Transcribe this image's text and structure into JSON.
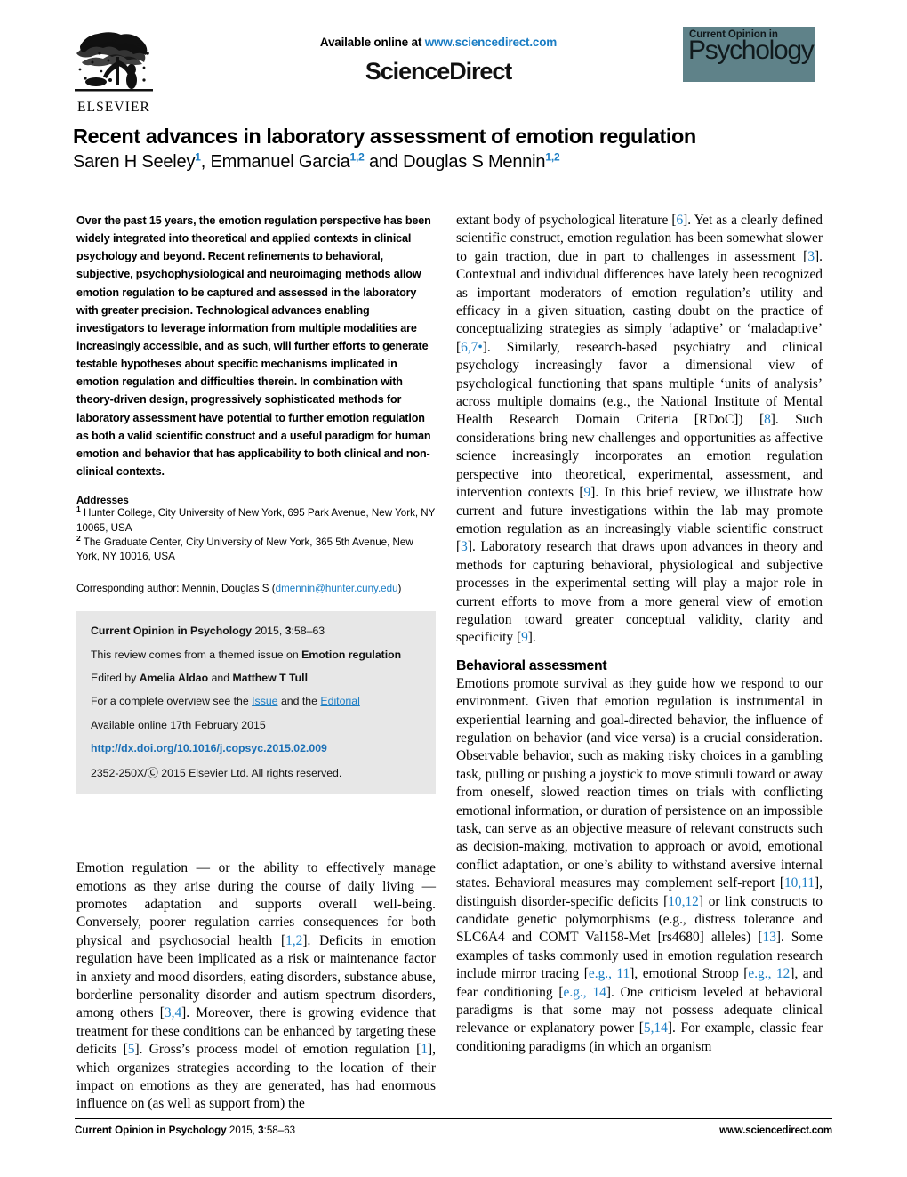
{
  "masthead": {
    "available_online_prefix": "Available online at ",
    "sciencedirect_url": "www.sciencedirect.com",
    "sciencedirect_wordmark": "ScienceDirect",
    "elsevier_wordmark": "ELSEVIER",
    "journal_badge_line1": "Current Opinion in",
    "journal_badge_line2": "Psychology",
    "badge_color": "#5f8289",
    "link_color": "#1a7dc4"
  },
  "title": {
    "article_title": "Recent advances in laboratory assessment of emotion regulation",
    "authors_plain": "Saren H Seeley1, Emmanuel Garcia1,2 and Douglas S Mennin1,2",
    "author_parts": [
      {
        "name": "Saren H Seeley",
        "sup": "1",
        "sep": ", "
      },
      {
        "name": "Emmanuel Garcia",
        "sup": "1,2",
        "sep": " and "
      },
      {
        "name": "Douglas S Mennin",
        "sup": "1,2",
        "sep": ""
      }
    ]
  },
  "abstract": {
    "text": "Over the past 15 years, the emotion regulation perspective has been widely integrated into theoretical and applied contexts in clinical psychology and beyond. Recent refinements to behavioral, subjective, psychophysiological and neuroimaging methods allow emotion regulation to be captured and assessed in the laboratory with greater precision. Technological advances enabling investigators to leverage information from multiple modalities are increasingly accessible, and as such, will further efforts to generate testable hypotheses about specific mechanisms implicated in emotion regulation and difficulties therein. In combination with theory-driven design, progressively sophisticated methods for laboratory assessment have potential to further emotion regulation as both a valid scientific construct and a useful paradigm for human emotion and behavior that has applicability to both clinical and non-clinical contexts."
  },
  "addresses": {
    "heading": "Addresses",
    "items": [
      {
        "sup": "1",
        "text": " Hunter College, City University of New York, 695 Park Avenue, New York, NY 10065, USA"
      },
      {
        "sup": "2",
        "text": " The Graduate Center, City University of New York, 365 5th Avenue, New York, NY 10016, USA"
      }
    ],
    "corresponding_prefix": "Corresponding author: Mennin, Douglas S (",
    "corresponding_email": "dmennin@hunter.cuny.edu",
    "corresponding_suffix": ")"
  },
  "info_box": {
    "citation_bold": "Current Opinion in Psychology",
    "citation_rest_a": " 2015, ",
    "citation_volume": "3",
    "citation_rest_b": ":58–63",
    "themed_prefix": "This review comes from a themed issue on ",
    "themed_bold": "Emotion regulation",
    "edited_prefix": "Edited by ",
    "editor1": "Amelia Aldao",
    "edited_mid": " and ",
    "editor2": "Matthew T Tull",
    "overview_prefix": "For a complete overview see the ",
    "overview_link1": "Issue",
    "overview_mid": " and the ",
    "overview_link2": "Editorial",
    "available_online": "Available online 17th February 2015",
    "doi": "http://dx.doi.org/10.1016/j.copsyc.2015.02.009",
    "copyright": "2352-250X/Ⓒ 2015 Elsevier Ltd. All rights reserved."
  },
  "body": {
    "left_paragraph_1_pre": "Emotion regulation — or the ability to effectively manage emotions as they arise during the course of daily living — promotes adaptation and supports overall well-being. Conversely, poorer regulation carries consequences for both physical and psychosocial health [",
    "left_ref_1_2": "1,2",
    "left_p1_b": "]. Deficits in emotion regulation have been implicated as a risk or maintenance factor in anxiety and mood disorders, eating disorders, substance abuse, borderline personality disorder and autism spectrum disorders, among others [",
    "left_ref_3_4": "3,4",
    "left_p1_c": "]. Moreover, there is growing evidence that treatment for these conditions can be enhanced by targeting these deficits [",
    "left_ref_5": "5",
    "left_p1_d": "]. Gross’s process model of emotion regulation [",
    "left_ref_1": "1",
    "left_p1_e": "], which organizes strategies according to the location of their impact on emotions as they are generated, has had enormous influence on (as well as support from) the",
    "right_p1_a": "extant body of psychological literature [",
    "right_ref_6": "6",
    "right_p1_b": "]. Yet as a clearly defined scientific construct, emotion regulation has been somewhat slower to gain traction, due in part to challenges in assessment [",
    "right_ref_3": "3",
    "right_p1_c": "]. Contextual and individual differences have lately been recognized as important moderators of emotion regulation’s utility and efficacy in a given situation, casting doubt on the practice of conceptualizing strategies as simply ‘adaptive’ or ‘maladaptive’ [",
    "right_ref_6_7": "6,7",
    "right_ref_6_7_mark": "•",
    "right_p1_d": "]. Similarly, research-based psychiatry and clinical psychology increasingly favor a dimensional view of psychological functioning that spans multiple ‘units of analysis’ across multiple domains (e.g., the National Institute of Mental Health Research Domain Criteria [RDoC]) [",
    "right_ref_8": "8",
    "right_p1_e": "]. Such considerations bring new challenges and opportunities as affective science increasingly incorporates an emotion regulation perspective into theoretical, experimental, assessment, and intervention contexts [",
    "right_ref_9": "9",
    "right_p1_f": "]. In this brief review, we illustrate how current and future investigations within the lab may promote emotion regulation as an increasingly viable scientific construct [",
    "right_ref_3b": "3",
    "right_p1_g": "]. Laboratory research that draws upon advances in theory and methods for capturing behavioral, physiological and subjective processes in the experimental setting will play a major role in current efforts to move from a more general view of emotion regulation toward greater conceptual validity, clarity and specificity [",
    "right_ref_9b": "9",
    "right_p1_h": "].",
    "section_heading": "Behavioral assessment",
    "right_p2_a": "Emotions promote survival as they guide how we respond to our environment. Given that emotion regulation is instrumental in experiential learning and goal-directed behavior, the influence of regulation on behavior (and vice versa) is a crucial consideration. Observable behavior, such as making risky choices in a gambling task, pulling or pushing a joystick to move stimuli toward or away from oneself, slowed reaction times on trials with conflicting emotional information, or duration of persistence on an impossible task, can serve as an objective measure of relevant constructs such as decision-making, motivation to approach or avoid, emotional conflict adaptation, or one’s ability to withstand aversive internal states. Behavioral measures may complement self-report [",
    "right_ref_10_11": "10,11",
    "right_p2_b": "], distinguish disorder-specific deficits [",
    "right_ref_10_12": "10,12",
    "right_p2_c": "] or link constructs to candidate genetic polymorphisms (e.g., distress tolerance and SLC6A4 and COMT Val158-Met [rs4680] alleles) [",
    "right_ref_13": "13",
    "right_p2_d": "]. Some examples of tasks commonly used in emotion regulation research include mirror tracing [",
    "right_ref_eg11": "e.g., 11",
    "right_p2_e": "], emotional Stroop [",
    "right_ref_eg12": "e.g., 12",
    "right_p2_f": "], and fear conditioning [",
    "right_ref_eg14": "e.g., 14",
    "right_p2_g": "]. One criticism leveled at behavioral paradigms is that some may not possess adequate clinical relevance or explanatory power [",
    "right_ref_5_14": "5,14",
    "right_p2_h": "]. For example, classic fear conditioning paradigms (in which an organism"
  },
  "footer": {
    "left_bold": "Current Opinion in Psychology",
    "left_rest": " 2015, ",
    "left_volume": "3",
    "left_pages": ":58–63",
    "right": "www.sciencedirect.com"
  }
}
